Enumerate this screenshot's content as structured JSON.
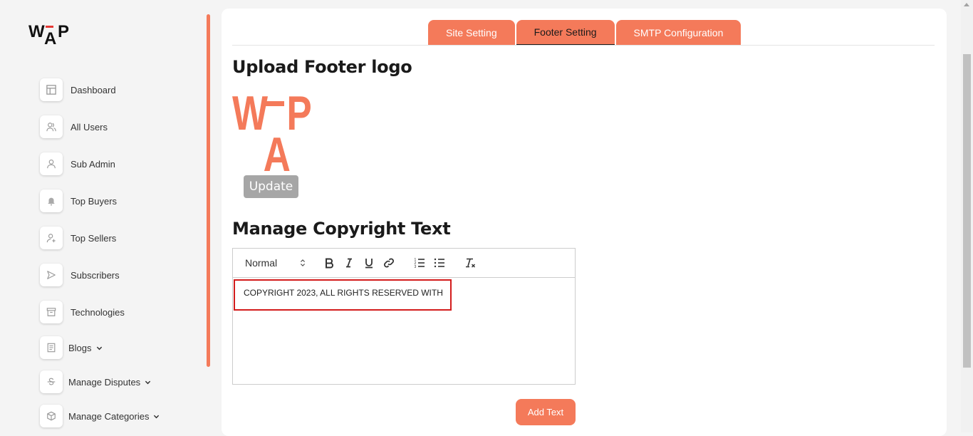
{
  "brand": {
    "logo_text": "WAP",
    "accent": "#f47a5a"
  },
  "sidebar": {
    "items": [
      {
        "label": "Dashboard",
        "icon": "dashboard-icon",
        "has_chevron": false
      },
      {
        "label": "All Users",
        "icon": "users-icon",
        "has_chevron": false
      },
      {
        "label": "Sub Admin",
        "icon": "user-icon",
        "has_chevron": false
      },
      {
        "label": "Top Buyers",
        "icon": "bell-icon",
        "has_chevron": false
      },
      {
        "label": "Top Sellers",
        "icon": "user-plus-icon",
        "has_chevron": false
      },
      {
        "label": "Subscribers",
        "icon": "send-icon",
        "has_chevron": false
      },
      {
        "label": "Technologies",
        "icon": "archive-icon",
        "has_chevron": false
      },
      {
        "label": "Blogs",
        "icon": "document-icon",
        "has_chevron": true
      },
      {
        "label": "Manage Disputes",
        "icon": "dollar-icon",
        "has_chevron": true
      },
      {
        "label": "Manage Categories",
        "icon": "box-icon",
        "has_chevron": true
      }
    ]
  },
  "tabs": [
    {
      "label": "Site Setting",
      "active": false
    },
    {
      "label": "Footer Setting",
      "active": true
    },
    {
      "label": "SMTP Configuration",
      "active": false
    }
  ],
  "upload": {
    "title": "Upload Footer logo",
    "update_label": "Update"
  },
  "copyright": {
    "title": "Manage Copyright Text",
    "format_select": "Normal",
    "text": "COPYRIGHT 2023, ALL RIGHTS RESERVED WITH",
    "add_label": "Add Text"
  }
}
